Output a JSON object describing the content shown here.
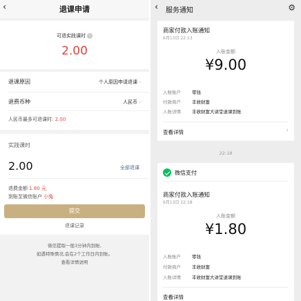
{
  "left": {
    "title": "退课申请",
    "back_glyph": "‹",
    "refundable_label": "可退实践课时",
    "refundable_value": "2.00",
    "reason_label": "退课原因",
    "reason_value": "个人原因申请退课",
    "currency_label": "退费币种",
    "currency_value": "人民币",
    "max_refund_label": "人民币最多可退课时:",
    "max_refund_value": "2.00",
    "actual_label": "实践课时",
    "actual_value": "2.00",
    "refund_all": "全部退课",
    "refund_amount_label": "退费金额",
    "refund_amount_value": "1.80 元",
    "account_label": "到账至微信账户",
    "account_name": "小兔",
    "submit": "提交",
    "record_link": "退课记录",
    "notice_line1": "微信提取一般3分钟内到账,",
    "notice_line2": "如遇特殊情况,会在2个工作日内到账。",
    "notice_link": "查看详情说明"
  },
  "right": {
    "nav_title": "服务通知",
    "back_glyph": "‹",
    "gear_glyph": "⚙",
    "messages": [
      {
        "title": "商家付款入账通知",
        "date": "6月13日  22:13",
        "amount_label": "入账金额",
        "amount": "¥9.00",
        "rows": [
          {
            "k": "入账账户",
            "v": "零钱"
          },
          {
            "k": "付款商户",
            "v": "丰收财富"
          },
          {
            "k": "入账详情",
            "v": "丰收财富大讲堂退课到账"
          }
        ],
        "detail": "查看详情"
      },
      {
        "sender": "微信支付",
        "title": "商家付款入账通知",
        "date": "6月13日  22:18",
        "amount_label": "入账金额",
        "amount": "¥1.80",
        "rows": [
          {
            "k": "入账账户",
            "v": "零钱"
          },
          {
            "k": "付款商户",
            "v": "丰收财富"
          },
          {
            "k": "入账详情",
            "v": "丰收财富大讲堂退课到账"
          }
        ],
        "detail": "查看详情"
      }
    ],
    "time_separator": "22:18"
  },
  "colors": {
    "accent_red": "#e5423b",
    "submit_gold": "#c9b080",
    "link_blue": "#576b95",
    "wechat_green": "#07c160"
  }
}
